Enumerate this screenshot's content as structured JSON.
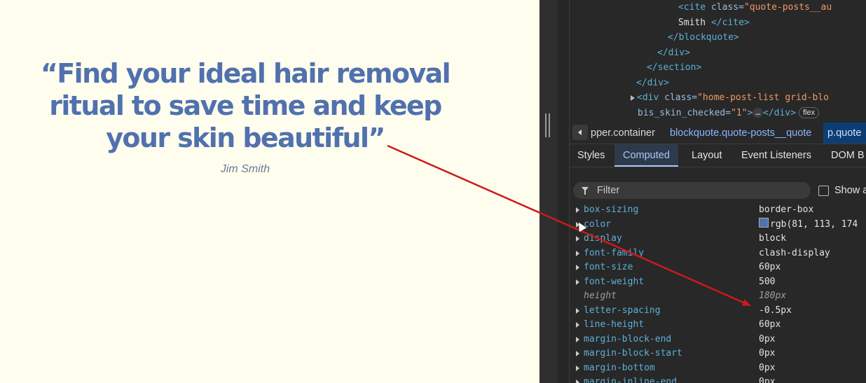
{
  "page": {
    "quote_lines": [
      "“Find your ideal hair removal",
      "ritual to save time and keep",
      "your skin beautiful”"
    ],
    "author": "Jim Smith"
  },
  "devtools": {
    "dom_lines": [
      {
        "indent": 198,
        "parts": [
          [
            "tag",
            "<cite "
          ],
          [
            "attr",
            "class="
          ],
          [
            "val",
            "\"quote-posts__au"
          ]
        ]
      },
      {
        "indent": 198,
        "parts": [
          [
            "txt",
            "Smith "
          ],
          [
            "tag",
            "</cite>"
          ]
        ]
      },
      {
        "indent": 183,
        "parts": [
          [
            "tag",
            "</blockquote>"
          ]
        ]
      },
      {
        "indent": 168,
        "parts": [
          [
            "tag",
            "</div>"
          ]
        ]
      },
      {
        "indent": 153,
        "parts": [
          [
            "tag",
            "</section>"
          ]
        ]
      },
      {
        "indent": 138,
        "parts": [
          [
            "tag",
            "</div>"
          ]
        ]
      },
      {
        "indent": 130,
        "triangle": true,
        "parts": [
          [
            "tag",
            "<div "
          ],
          [
            "attr",
            "class="
          ],
          [
            "val",
            "\"home-post-list grid-blo"
          ]
        ]
      },
      {
        "indent": 140,
        "parts": [
          [
            "attr",
            "bis_skin_checked="
          ],
          [
            "val",
            "\"1\""
          ],
          [
            "tag",
            ">"
          ]
        ],
        "ellipsis": "…",
        "tail": "</div>",
        "badge": "flex"
      }
    ],
    "breadcrumbs": [
      "pper.container",
      "blockquote.quote-posts__quote",
      "p.quote"
    ],
    "tabs": [
      "Styles",
      "Computed",
      "Layout",
      "Event Listeners",
      "DOM B"
    ],
    "active_tab": "Computed",
    "filter_placeholder": "Filter",
    "show_all_label": "Show a",
    "properties": [
      {
        "name": "box-sizing",
        "value": "border-box"
      },
      {
        "name": "color",
        "value": "rgb(81, 113, 174",
        "swatch": "#5171ae"
      },
      {
        "name": "display",
        "value": "block"
      },
      {
        "name": "font-family",
        "value": "clash-display"
      },
      {
        "name": "font-size",
        "value": "60px"
      },
      {
        "name": "font-weight",
        "value": "500"
      },
      {
        "name": "height",
        "value": "180px",
        "inherited": true
      },
      {
        "name": "letter-spacing",
        "value": "-0.5px"
      },
      {
        "name": "line-height",
        "value": "60px"
      },
      {
        "name": "margin-block-end",
        "value": "0px"
      },
      {
        "name": "margin-block-start",
        "value": "0px"
      },
      {
        "name": "margin-bottom",
        "value": "0px"
      },
      {
        "name": "margin-inline-end",
        "value": "0px"
      }
    ]
  },
  "colors": {
    "quote": "#5171ae",
    "annotation_arrow": "#cc1a1a",
    "page_bg": "#fffdee"
  }
}
